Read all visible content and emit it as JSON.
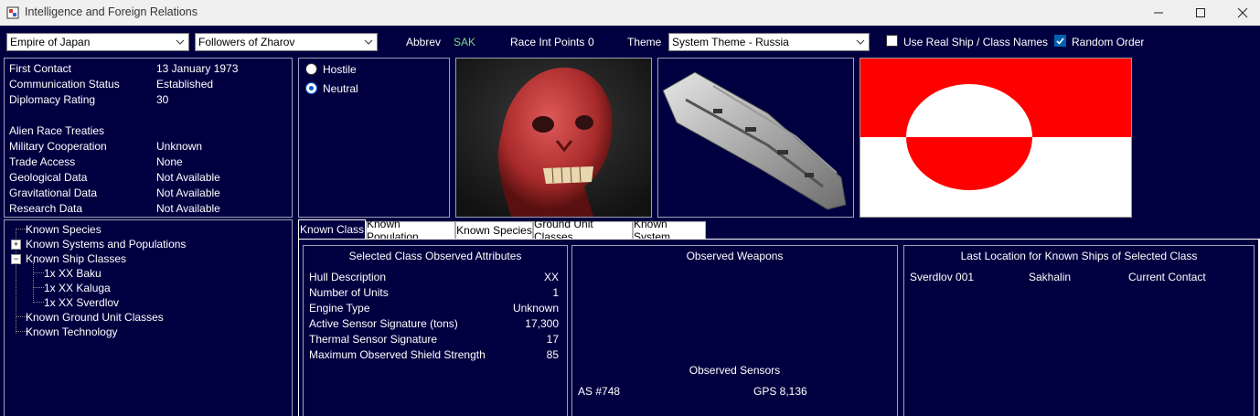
{
  "window": {
    "title": "Intelligence and Foreign Relations"
  },
  "toolbar": {
    "empire": "Empire of Japan",
    "alien_race": "Followers of Zharov",
    "abbrev_label": "Abbrev",
    "abbrev_value": "SAK",
    "race_int_label": "Race Int Points",
    "race_int_value": "0",
    "theme_label": "Theme",
    "theme_value": "System Theme - Russia",
    "use_real_names_label": "Use Real Ship / Class Names",
    "use_real_names_checked": false,
    "random_order_label": "Random Order",
    "random_order_checked": true
  },
  "relations": {
    "rows": [
      {
        "label": "First Contact",
        "value": "13 January 1973"
      },
      {
        "label": "Communication Status",
        "value": "Established"
      },
      {
        "label": "Diplomacy Rating",
        "value": "30"
      }
    ],
    "treaties_header": "Alien Race Treaties",
    "treaties": [
      {
        "label": "Military Cooperation",
        "value": "Unknown"
      },
      {
        "label": "Trade Access",
        "value": "None"
      },
      {
        "label": "Geological Data",
        "value": "Not Available"
      },
      {
        "label": "Gravitational Data",
        "value": "Not Available"
      },
      {
        "label": "Research Data",
        "value": "Not Available"
      }
    ]
  },
  "stance": {
    "hostile": "Hostile",
    "neutral": "Neutral",
    "selected": "neutral"
  },
  "flag": {
    "top_color": "#ff0000",
    "bottom_color": "#ffffff"
  },
  "tree": {
    "known_species": "Known Species",
    "known_systems": "Known Systems and Populations",
    "known_ship_classes": "Known Ship Classes",
    "ship_classes": [
      "1x XX Baku",
      "1x XX Kaluga",
      "1x XX Sverdlov"
    ],
    "known_ground_units": "Known Ground Unit Classes",
    "known_technology": "Known Technology"
  },
  "tabs": [
    "Known Class",
    "Known Population",
    "Known Species",
    "Ground Unit Classes",
    "Known System"
  ],
  "class_attributes": {
    "title": "Selected Class Observed Attributes",
    "rows": [
      {
        "label": "Hull Description",
        "value": "XX"
      },
      {
        "label": "Number of Units",
        "value": "1"
      },
      {
        "label": "Engine Type",
        "value": "Unknown"
      },
      {
        "label": "Active Sensor Signature (tons)",
        "value": "17,300"
      },
      {
        "label": "Thermal Sensor Signature",
        "value": "17"
      },
      {
        "label": "Maximum Observed Shield Strength",
        "value": "85"
      }
    ]
  },
  "weapons": {
    "title": "Observed Weapons",
    "sensors_title": "Observed Sensors",
    "sensors": [
      "AS #748",
      "GPS 8,136"
    ]
  },
  "locations": {
    "title": "Last Location for Known Ships of Selected Class",
    "rows": [
      {
        "ship": "Sverdlov 001",
        "location": "Sakhalin",
        "status": "Current Contact"
      }
    ]
  }
}
